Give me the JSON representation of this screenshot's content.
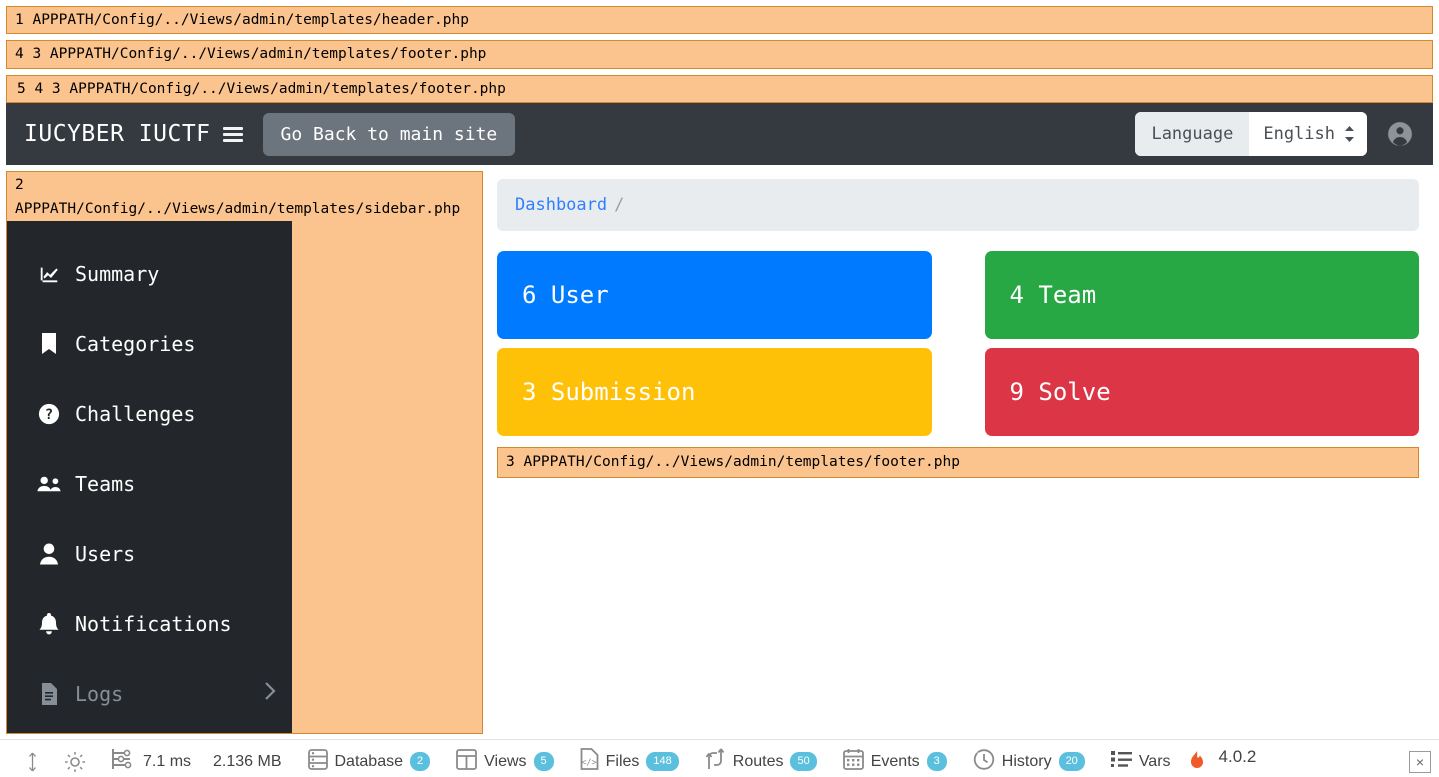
{
  "debug_views": {
    "header_view": "1 APPPATH/Config/../Views/admin/templates/header.php",
    "footer_view_a": "4 3 APPPATH/Config/../Views/admin/templates/footer.php",
    "footer_view_b": "5 4 3 APPPATH/Config/../Views/admin/templates/footer.php",
    "sidebar_view": "2\nAPPPATH/Config/../Views/admin/templates/sidebar.php",
    "footer_view_c": "3 APPPATH/Config/../Views/admin/templates/footer.php"
  },
  "navbar": {
    "brand": "IUCYBER IUCTF",
    "menu_icon": "hamburger-icon",
    "back_button": "Go Back to main site",
    "language_label": "Language",
    "language_value": "English",
    "language_options": [
      "English"
    ],
    "account_icon": "user-circle-icon"
  },
  "sidebar": {
    "items": [
      {
        "label": "Summary",
        "icon": "chart-line-icon",
        "muted": false,
        "chevron": false
      },
      {
        "label": "Categories",
        "icon": "bookmark-icon",
        "muted": false,
        "chevron": false
      },
      {
        "label": "Challenges",
        "icon": "question-circle-icon",
        "muted": false,
        "chevron": false
      },
      {
        "label": "Teams",
        "icon": "users-icon",
        "muted": false,
        "chevron": false
      },
      {
        "label": "Users",
        "icon": "user-icon",
        "muted": false,
        "chevron": false
      },
      {
        "label": "Notifications",
        "icon": "bell-icon",
        "muted": false,
        "chevron": false
      },
      {
        "label": "Logs",
        "icon": "file-text-icon",
        "muted": true,
        "chevron": true
      }
    ]
  },
  "main": {
    "breadcrumb": {
      "link": "Dashboard",
      "separator": "/"
    },
    "cards": [
      {
        "count": "6",
        "label": "User",
        "color": "#007bff"
      },
      {
        "count": "4",
        "label": "Team",
        "color": "#28a745"
      },
      {
        "count": "3",
        "label": "Submission",
        "color": "#ffc107"
      },
      {
        "count": "9",
        "label": "Solve",
        "color": "#dc3545"
      }
    ]
  },
  "debug_toolbar": {
    "resize_icon": "updown-arrow-icon",
    "theme_icon": "sun-icon",
    "timer_icon": "sliders-icon",
    "time": "7.1 ms",
    "memory": "2.136 MB",
    "items": [
      {
        "label": "Database",
        "badge": "2",
        "icon": "database-icon"
      },
      {
        "label": "Views",
        "badge": "5",
        "icon": "views-icon"
      },
      {
        "label": "Files",
        "badge": "148",
        "icon": "files-code-icon"
      },
      {
        "label": "Routes",
        "badge": "50",
        "icon": "routes-icon"
      },
      {
        "label": "Events",
        "badge": "3",
        "icon": "calendar-icon"
      },
      {
        "label": "History",
        "badge": "20",
        "icon": "history-clock-icon"
      },
      {
        "label": "Vars",
        "badge": "",
        "icon": "list-icon"
      }
    ],
    "framework_icon": "flame-icon",
    "version": "4.0.2",
    "close_label": "×"
  }
}
